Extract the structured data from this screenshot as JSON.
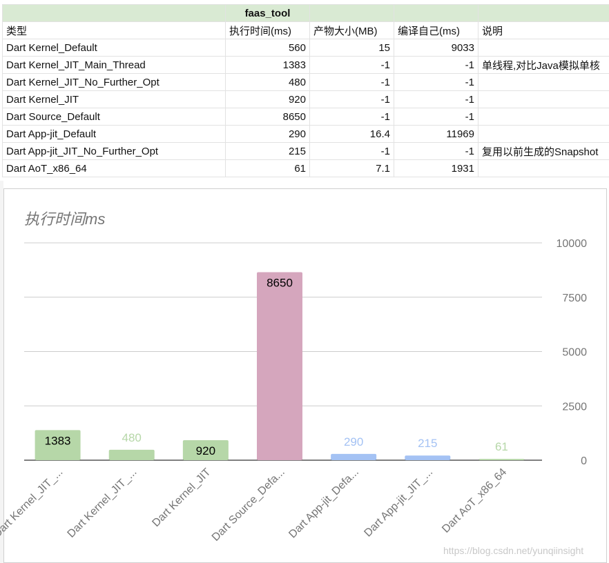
{
  "sheet": {
    "title": "faas_tool",
    "headers": [
      "类型",
      "执行时间(ms)",
      "产物大小(MB)",
      "编译自己(ms)",
      "说明"
    ],
    "rows": [
      [
        "Dart Kernel_Default",
        "560",
        "15",
        "9033",
        ""
      ],
      [
        "Dart Kernel_JIT_Main_Thread",
        "1383",
        "-1",
        "-1",
        "单线程,对比Java模拟单核"
      ],
      [
        "Dart Kernel_JIT_No_Further_Opt",
        "480",
        "-1",
        "-1",
        ""
      ],
      [
        "Dart Kernel_JIT",
        "920",
        "-1",
        "-1",
        ""
      ],
      [
        "Dart Source_Default",
        "8650",
        "-1",
        "-1",
        ""
      ],
      [
        "Dart App-jit_Default",
        "290",
        "16.4",
        "11969",
        ""
      ],
      [
        "Dart App-jit_JIT_No_Further_Opt",
        "215",
        "-1",
        "-1",
        "复用以前生成的Snapshot"
      ],
      [
        "Dart AoT_x86_64",
        "61",
        "7.1",
        "1931",
        ""
      ]
    ]
  },
  "chart_data": {
    "type": "bar",
    "title": "执行时间ms",
    "categories": [
      "Dart Kernel_JIT_...",
      "Dart Kernel_JIT_...",
      "Dart Kernel_JIT",
      "Dart Source_Defa...",
      "Dart App-jit_Defa...",
      "Dart App-jit_JIT_...",
      "Dart AoT_x86_64"
    ],
    "values": [
      1383,
      480,
      920,
      8650,
      290,
      215,
      61
    ],
    "colors": [
      "#b6d7a8",
      "#b6d7a8",
      "#b6d7a8",
      "#d5a6bd",
      "#a4c2f4",
      "#a4c2f4",
      "#b6d7a8"
    ],
    "label_colors": [
      "#000000",
      "#b6d7a8",
      "#000000",
      "#000000",
      "#a4c2f4",
      "#a4c2f4",
      "#b6d7a8"
    ],
    "label_inside": [
      true,
      false,
      true,
      true,
      false,
      false,
      false
    ],
    "ylim": [
      0,
      10000
    ],
    "yticks": [
      0,
      2500,
      5000,
      7500,
      10000
    ],
    "ytick_labels": [
      "0",
      "2500",
      "5000",
      "7500",
      "10000"
    ],
    "y_axis_side": "right",
    "grid": true,
    "legend": "none"
  },
  "watermark": "https://blog.csdn.net/yunqiinsight"
}
